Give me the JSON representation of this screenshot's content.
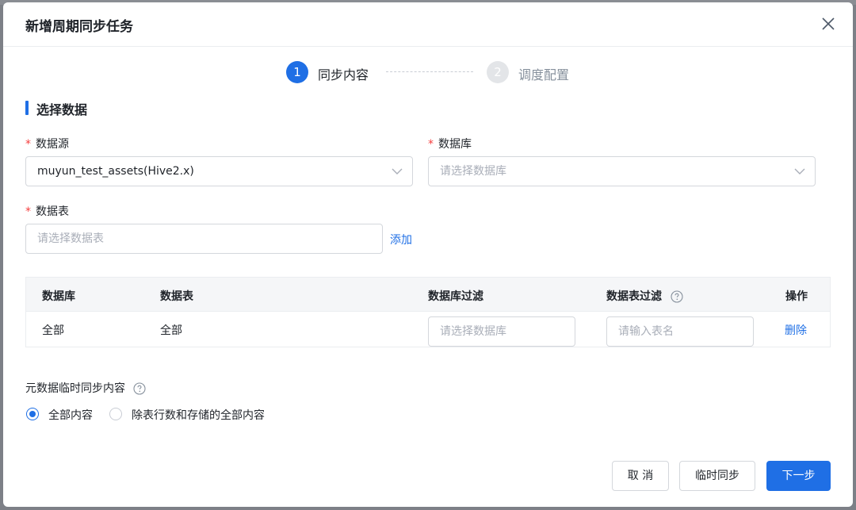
{
  "modal": {
    "title": "新增周期同步任务",
    "close_icon": "close-icon"
  },
  "steps": [
    {
      "number": "1",
      "label": "同步内容",
      "status": "active"
    },
    {
      "number": "2",
      "label": "调度配置",
      "status": "inactive"
    }
  ],
  "section": {
    "title": "选择数据"
  },
  "form": {
    "datasource": {
      "label": "数据源",
      "required": true,
      "value": "muyun_test_assets(Hive2.x)"
    },
    "database": {
      "label": "数据库",
      "required": true,
      "placeholder": "请选择数据库"
    },
    "table": {
      "label": "数据表",
      "required": true,
      "placeholder": "请选择数据表",
      "add_label": "添加"
    }
  },
  "table": {
    "headers": {
      "database": "数据库",
      "table": "数据表",
      "database_filter": "数据库过滤",
      "table_filter": "数据表过滤",
      "action": "操作"
    },
    "rows": [
      {
        "database": "全部",
        "table": "全部",
        "database_filter_placeholder": "请选择数据库",
        "table_filter_placeholder": "请输入表名",
        "action": "删除"
      }
    ]
  },
  "metadata_sync": {
    "label": "元数据临时同步内容",
    "options": [
      {
        "label": "全部内容",
        "checked": true
      },
      {
        "label": "除表行数和存储的全部内容",
        "checked": false
      }
    ]
  },
  "footer": {
    "cancel": "取 消",
    "temp_sync": "临时同步",
    "next": "下一步"
  },
  "colors": {
    "primary": "#1f6fe5",
    "required": "#f53f3f",
    "placeholder": "#a9aeb8"
  }
}
